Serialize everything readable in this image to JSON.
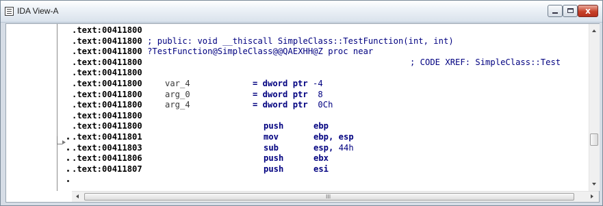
{
  "window": {
    "title": "IDA View-A",
    "close_glyph": "x"
  },
  "lines": [
    {
      "addr": ".text:00411800",
      "text": ""
    },
    {
      "addr": ".text:00411800",
      "text": " ; public: void __thiscall SimpleClass::TestFunction(int, int)"
    },
    {
      "addr": ".text:00411800",
      "text": " ?TestFunction@SimpleClass@@QAEXHH@Z proc near"
    },
    {
      "addr": ".text:00411800",
      "text": "",
      "xref": "; CODE XREF: SimpleClass::Test"
    },
    {
      "addr": ".text:00411800",
      "text": ""
    },
    {
      "addr": ".text:00411800",
      "var": "var_4",
      "eq": "= dword ptr",
      "val": " -4"
    },
    {
      "addr": ".text:00411800",
      "var": "arg_0",
      "eq": "= dword ptr",
      "val": "  8"
    },
    {
      "addr": ".text:00411800",
      "var": "arg_4",
      "eq": "= dword ptr",
      "val": "  0Ch"
    },
    {
      "addr": ".text:00411800",
      "text": ""
    },
    {
      "addr": ".text:00411800",
      "ins": "push",
      "op": "ebp"
    },
    {
      "addr": ".text:00411801",
      "ins": "mov",
      "op": "ebp, esp"
    },
    {
      "addr": ".text:00411803",
      "ins": "sub",
      "op": "esp, ",
      "opnum": "44h"
    },
    {
      "addr": ".text:00411806",
      "ins": "push",
      "op": "ebx"
    },
    {
      "addr": ".text:00411807",
      "ins": "push",
      "op": "esi"
    }
  ],
  "hscroll_grip": "III",
  "icons": [
    "document-icon",
    "minimize-icon",
    "maximize-icon",
    "close-icon",
    "scroll-up-icon",
    "scroll-down-icon",
    "scroll-left-icon",
    "scroll-right-icon",
    "jump-arrow-icon"
  ]
}
